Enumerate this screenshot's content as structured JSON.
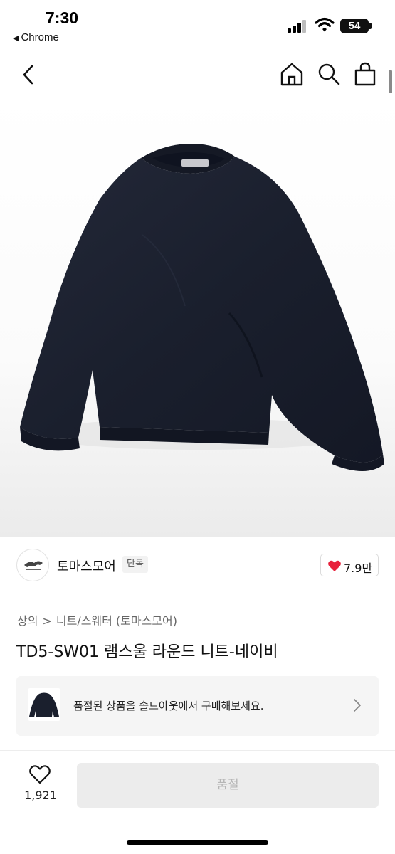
{
  "status_bar": {
    "time": "7:30",
    "back_app": "Chrome",
    "battery": "54"
  },
  "nav": {
    "icons": [
      "chevron-left-icon",
      "home-icon",
      "search-icon",
      "shopping-bag-icon"
    ]
  },
  "product_image": {
    "subject": "navy knit sweater",
    "colors": {
      "sweater": "#1b2030",
      "background": "#f7f7f7"
    }
  },
  "brand": {
    "name": "토마스모어",
    "badge": "단독",
    "likes": "7.9만",
    "heart_color": "#e8213b"
  },
  "breadcrumb": {
    "category": "상의",
    "separator": ">",
    "subcategory": "니트/스웨터 (토마스모어)"
  },
  "product": {
    "title": "TD5-SW01 램스울 라운드 니트-네이비"
  },
  "soldout_banner": {
    "text": "품절된 상품을 솔드아웃에서 구매해보세요."
  },
  "bottom_bar": {
    "wish_count": "1,921",
    "buy_label": "품절"
  }
}
